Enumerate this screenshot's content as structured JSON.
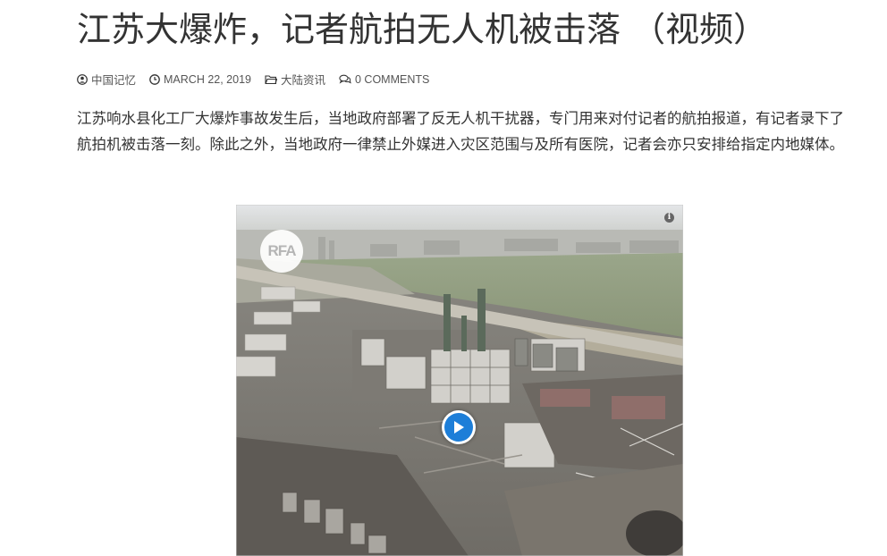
{
  "article": {
    "title": "江苏大爆炸，记者航拍无人机被击落 （视频）",
    "meta": {
      "author": "中国记忆",
      "date": "MARCH 22, 2019",
      "category": "大陆资讯",
      "comments": "0 COMMENTS"
    },
    "body": "江苏响水县化工厂大爆炸事故发生后，当地政府部署了反无人机干扰器，专门用来对付记者的航拍报道，有记者录下了航拍机被击落一刻。除此之外，当地政府一律禁止外媒进入灾区范围与及所有医院，记者会亦只安排给指定内地媒体。"
  },
  "video": {
    "logo_text": "RFA",
    "info_icon": "i",
    "play_icon": "play-icon",
    "accent_color": "#1d7ed8"
  }
}
